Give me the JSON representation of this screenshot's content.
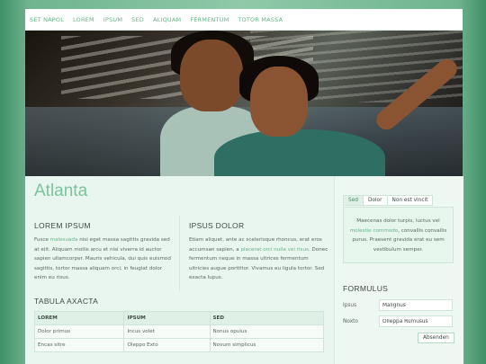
{
  "nav": [
    "SET NAPOL",
    "LOREM",
    "IPSUM",
    "SED",
    "ALIQUAM",
    "FERMENTUM",
    "TOTOR MASSA"
  ],
  "main": {
    "title": "Atlanta",
    "col1": {
      "heading": "LOREM IPSUM",
      "pre": "Fusce ",
      "link": "malesuada",
      "post": " nisi eget massa sagittis gravida sed at elit. Aliquam mollis arcu et nisi viverra id auctor sapien ullamcorper. Mauris vehicula, dui quis euismod sagittis, tortor massa aliquam orci, in feugiat dolor enim eu risus."
    },
    "col2": {
      "heading": "IPSUS DOLOR",
      "pre": "Etiam aliquet, ante ac scelerisque rhoncus, erat eros accumsan sapien, a ",
      "link": "placerat orci nulla vel risus",
      "post": ". Donec fermentum neque in massa ultrices fermentum ultricies augue porttitor. Vivamus eu ligula tortor. Sed exacta lupus."
    },
    "table_title": "TABULA AXACTA",
    "table": {
      "headers": [
        "LOREM",
        "IPSUM",
        "SED"
      ],
      "rows": [
        [
          "Dolor primus",
          "Incus volet",
          "Nonus opulus"
        ],
        [
          "Encas sitre",
          "Oleppo Exto",
          "Novum simplicus"
        ]
      ]
    }
  },
  "side": {
    "tabs": [
      "Sed",
      "Dolor",
      "Non est vincit"
    ],
    "tab_pre": "Maecenas dolor turpis, luctus vel ",
    "tab_link": "molestie commodo",
    "tab_post": ", convallis convallis purus. Praesent gravida erat eu sem vestibulum semper.",
    "form_title": "FORMULUS",
    "form": [
      {
        "label": "Ipsus",
        "value": "Malignus"
      },
      {
        "label": "Noxto",
        "value": "Olleppa Rumusus"
      }
    ],
    "submit": "Absenden"
  },
  "colors": {
    "accent": "#64b58a",
    "background": "#eef8f2",
    "text": "#5a6660"
  }
}
